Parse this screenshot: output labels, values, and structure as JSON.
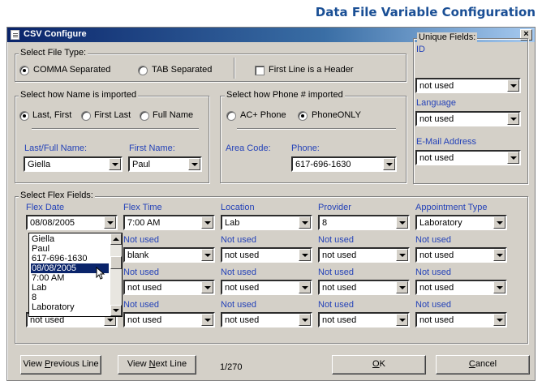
{
  "page_title": "Data File Variable Configuration",
  "window": {
    "title": "CSV Configure",
    "close_label": "×"
  },
  "file_type": {
    "group_label": "Select File Type:",
    "comma_label": "COMMA Separated",
    "tab_label": "TAB Separated",
    "header_label": "First Line is a Header",
    "selected": "COMMA Separated",
    "header_checked": false
  },
  "name_import": {
    "group_label": "Select how Name is imported",
    "options": [
      "Last, First",
      "First Last",
      "Full Name"
    ],
    "selected": "Last, First",
    "last_full_label": "Last/Full Name:",
    "last_full_value": "Giella",
    "first_label": "First Name:",
    "first_value": "Paul"
  },
  "phone_import": {
    "group_label": "Select how Phone # imported",
    "options": [
      "AC+ Phone",
      "PhoneONLY"
    ],
    "selected": "PhoneONLY",
    "area_label": "Area Code:",
    "phone_label": "Phone:",
    "phone_value": "617-696-1630"
  },
  "unique_fields": {
    "group_label": "Unique Fields:",
    "fields": [
      {
        "label": "ID",
        "value": "not used"
      },
      {
        "label": "Language",
        "value": "not used"
      },
      {
        "label": "E-Mail Address",
        "value": "not used"
      }
    ]
  },
  "flex_fields": {
    "group_label": "Select Flex Fields:",
    "columns": [
      {
        "header": "Flex Date",
        "value": "08/08/2005"
      },
      {
        "header": "Flex Time",
        "value": "7:00 AM"
      },
      {
        "header": "Location",
        "value": "Lab"
      },
      {
        "header": "Provider",
        "value": "8"
      },
      {
        "header": "Appointment Type",
        "value": "Laboratory"
      }
    ],
    "rows": [
      {
        "labels": [
          "",
          "Not used",
          "Not used",
          "Not used",
          "Not used"
        ],
        "values": [
          "",
          "blank",
          "not used",
          "not used",
          "not used"
        ]
      },
      {
        "labels": [
          "",
          "Not used",
          "Not used",
          "Not used",
          "Not used"
        ],
        "values": [
          "",
          "not used",
          "not used",
          "not used",
          "not used"
        ]
      },
      {
        "labels": [
          "",
          "Not used",
          "Not used",
          "Not used",
          "Not used"
        ],
        "values": [
          "not used",
          "not used",
          "not used",
          "not used",
          "not used"
        ]
      }
    ]
  },
  "dropdown": {
    "options": [
      "Giella",
      "Paul",
      "617-696-1630",
      "08/08/2005",
      "7:00 AM",
      "Lab",
      "8",
      "Laboratory"
    ],
    "selected": "08/08/2005"
  },
  "footer": {
    "prev_prefix": "View ",
    "prev_key": "P",
    "prev_rest": "revious Line",
    "next_prefix": "View ",
    "next_key": "N",
    "next_rest": "ext Line",
    "line_counter": "1/270",
    "ok_key": "O",
    "ok_rest": "K",
    "cancel_key": "C",
    "cancel_rest": "ancel"
  }
}
